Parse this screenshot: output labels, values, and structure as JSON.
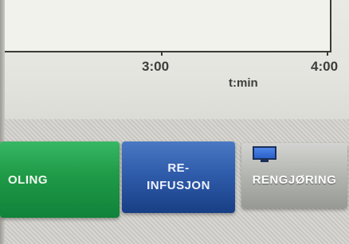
{
  "chart": {
    "x_ticks": [
      "3:00",
      "4:00"
    ],
    "x_unit": "t:min"
  },
  "buttons": {
    "green_label": "OLING",
    "blue_label_line1": "RE-",
    "blue_label_line2": "INFUSJON",
    "gray_label": "RENGJØRING",
    "gray_icon": "monitor-icon"
  },
  "colors": {
    "green": "#1f9a47",
    "blue": "#2f5cab",
    "gray": "#b0b2ad"
  }
}
